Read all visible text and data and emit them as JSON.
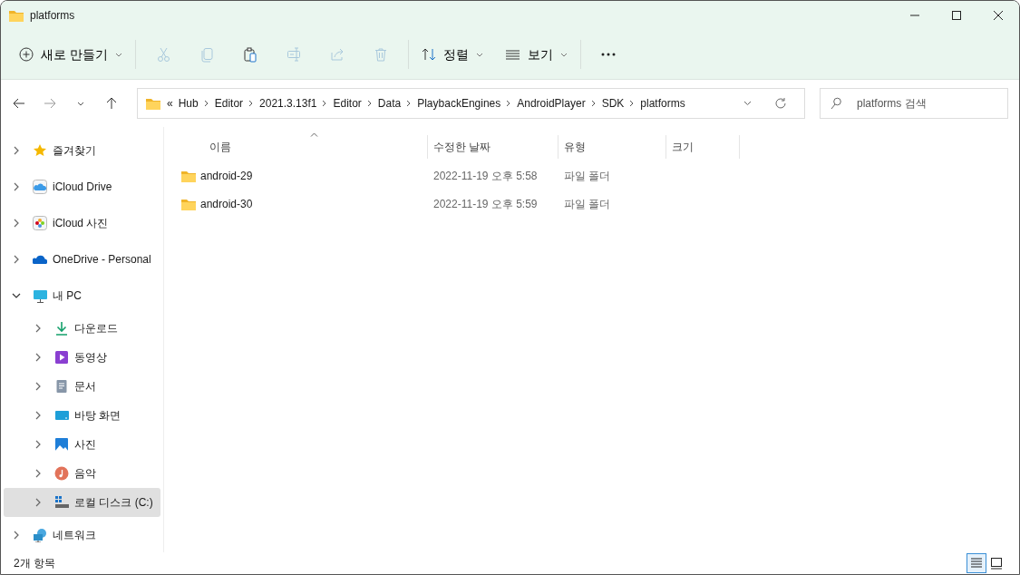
{
  "window": {
    "title": "platforms"
  },
  "toolbar": {
    "new_button": {
      "label": "새로 만들기"
    },
    "actions": [
      {
        "disabled": true
      },
      {
        "disabled": true
      },
      {
        "disabled": false
      },
      {
        "disabled": true
      },
      {
        "disabled": true
      },
      {
        "disabled": true
      }
    ],
    "sort_button": {
      "label": "정렬"
    },
    "view_button": {
      "label": "보기"
    }
  },
  "address_bar": {
    "overflow": "«",
    "segments": [
      "Hub",
      "Editor",
      "2021.3.13f1",
      "Editor",
      "Data",
      "PlaybackEngines",
      "AndroidPlayer",
      "SDK",
      "platforms"
    ]
  },
  "search": {
    "placeholder": "platforms 검색"
  },
  "sidebar": {
    "items": [
      {
        "label": "즐겨찾기",
        "expanded": false,
        "selected": false
      },
      {
        "label": "iCloud Drive",
        "expanded": false,
        "selected": false
      },
      {
        "label": "iCloud 사진",
        "expanded": false,
        "selected": false
      },
      {
        "label": "OneDrive - Personal",
        "expanded": false,
        "selected": false
      },
      {
        "label": "내 PC",
        "expanded": true,
        "selected": false,
        "children": [
          {
            "label": "다운로드",
            "expanded": false,
            "selected": false
          },
          {
            "label": "동영상",
            "expanded": false,
            "selected": false
          },
          {
            "label": "문서",
            "expanded": false,
            "selected": false
          },
          {
            "label": "바탕 화면",
            "expanded": false,
            "selected": false
          },
          {
            "label": "사진",
            "expanded": false,
            "selected": false
          },
          {
            "label": "음악",
            "expanded": false,
            "selected": false
          },
          {
            "label": "로컬 디스크 (C:)",
            "expanded": false,
            "selected": true
          }
        ]
      },
      {
        "label": "네트워크",
        "expanded": false,
        "selected": false
      }
    ]
  },
  "table": {
    "columns": [
      {
        "label": "이름",
        "sorted": true
      },
      {
        "label": "수정한 날짜",
        "sorted": false
      },
      {
        "label": "유형",
        "sorted": false
      },
      {
        "label": "크기",
        "sorted": false
      }
    ],
    "rows": [
      {
        "name": "android-29",
        "modified": "2022-11-19 오후 5:58",
        "type": "파일 폴더"
      },
      {
        "name": "android-30",
        "modified": "2022-11-19 오후 5:59",
        "type": "파일 폴더"
      }
    ]
  },
  "status_bar": {
    "item_count": "2개 항목",
    "views": [
      {
        "selected": true
      },
      {
        "selected": false
      }
    ]
  }
}
